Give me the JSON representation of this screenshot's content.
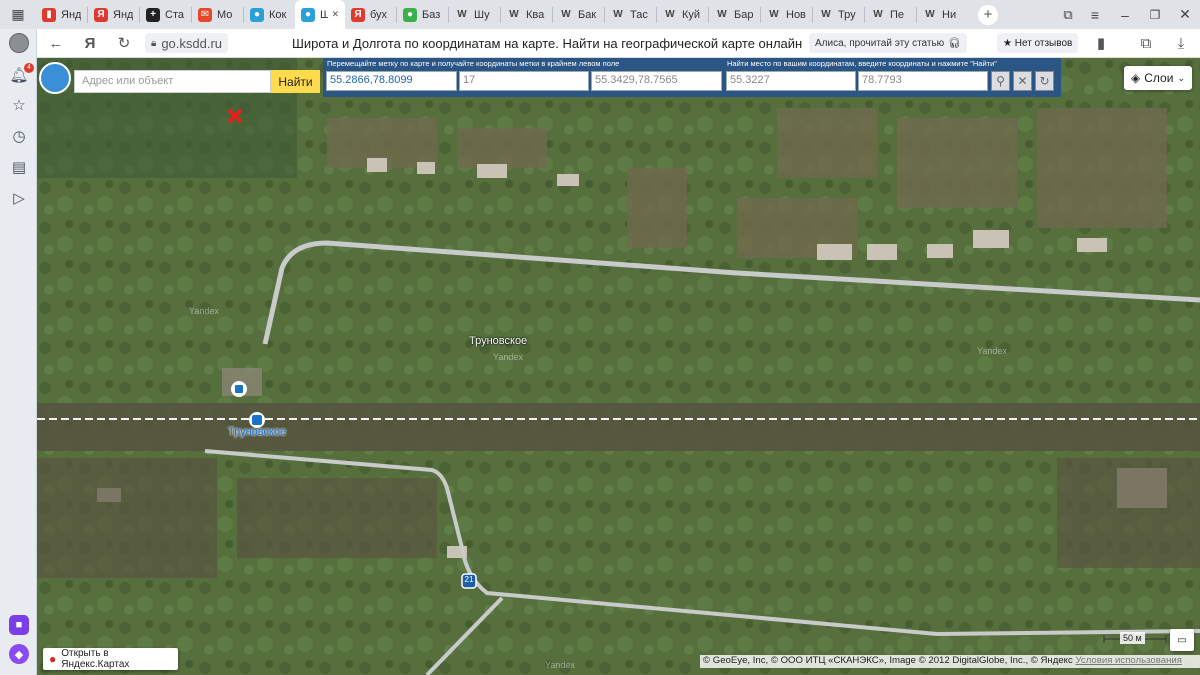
{
  "tabs": [
    {
      "icon": "yandex-zen-icon",
      "color": "#e03a2e",
      "glyph": "▮",
      "label": "Янд"
    },
    {
      "icon": "yandex-icon",
      "color": "#e03a2e",
      "glyph": "Я",
      "label": "Янд"
    },
    {
      "icon": "plus-icon",
      "color": "#222",
      "glyph": "+",
      "label": "Ста"
    },
    {
      "icon": "mail-icon",
      "color": "#e8452c",
      "glyph": "✉",
      "label": "Мо"
    },
    {
      "icon": "globe-icon",
      "color": "#29a1d8",
      "glyph": "●",
      "label": "Кок"
    },
    {
      "icon": "globe-icon",
      "color": "#29a1d8",
      "glyph": "●",
      "label": "Ш",
      "active": true
    },
    {
      "icon": "yandex-icon",
      "color": "#e03a2e",
      "glyph": "Я",
      "label": "бух"
    },
    {
      "icon": "green-icon",
      "color": "#3cb04a",
      "glyph": "●",
      "label": "Баз"
    },
    {
      "icon": "wikipedia-icon",
      "color": "#555",
      "glyph": "W",
      "label": "Шу"
    },
    {
      "icon": "wikipedia-icon",
      "color": "#555",
      "glyph": "W",
      "label": "Ква"
    },
    {
      "icon": "wikipedia-icon",
      "color": "#555",
      "glyph": "W",
      "label": "Бак"
    },
    {
      "icon": "wikipedia-icon",
      "color": "#555",
      "glyph": "W",
      "label": "Тас"
    },
    {
      "icon": "wikipedia-icon",
      "color": "#555",
      "glyph": "W",
      "label": "Куй"
    },
    {
      "icon": "wikipedia-icon",
      "color": "#555",
      "glyph": "W",
      "label": "Бар"
    },
    {
      "icon": "wikipedia-icon",
      "color": "#555",
      "glyph": "W",
      "label": "Нов"
    },
    {
      "icon": "wikipedia-icon",
      "color": "#555",
      "glyph": "W",
      "label": "Тру"
    },
    {
      "icon": "wikipedia-icon",
      "color": "#555",
      "glyph": "W",
      "label": "Пе"
    },
    {
      "icon": "wikipedia-icon",
      "color": "#555",
      "glyph": "W",
      "label": "Ни"
    }
  ],
  "browser": {
    "notification_count": "4",
    "domain": "go.ksdd.ru",
    "page_title": "Широта и Долгота по координатам на карте. Найти на географической карте онлайн",
    "alice_text": "Алиса, прочитай эту статью",
    "reviews_text": "★ Нет отзывов"
  },
  "coord_panel": {
    "move_label": "Перемещайте метку по карте и получайте координаты метки в крайнем левом поле",
    "find_label": "Найти место по вашим координатам, введите координаты и нажмите \"Найти\"",
    "marker_coords": "55.2866,78.8099",
    "zoom": "17",
    "corner_coords": "55.3429,78.7565",
    "lat_input": "55.3227",
    "lon_input": "78.7793"
  },
  "map": {
    "search_placeholder": "Адрес или объект",
    "find_button": "Найти",
    "layers_button": "Слои",
    "open_in_maps": "Открыть в Яндекс.Картах",
    "village_label": "Труновское",
    "station_label": "Труновское",
    "road_number": "21",
    "scale_label": "50 м",
    "copyright": "© GeoEye, Inc, © ООО ИТЦ «СКАНЭКС», Image © 2012 DigitalGlobe, Inc., © Яндекс",
    "terms_link": "Условия использования",
    "watermark": "Yandex"
  }
}
